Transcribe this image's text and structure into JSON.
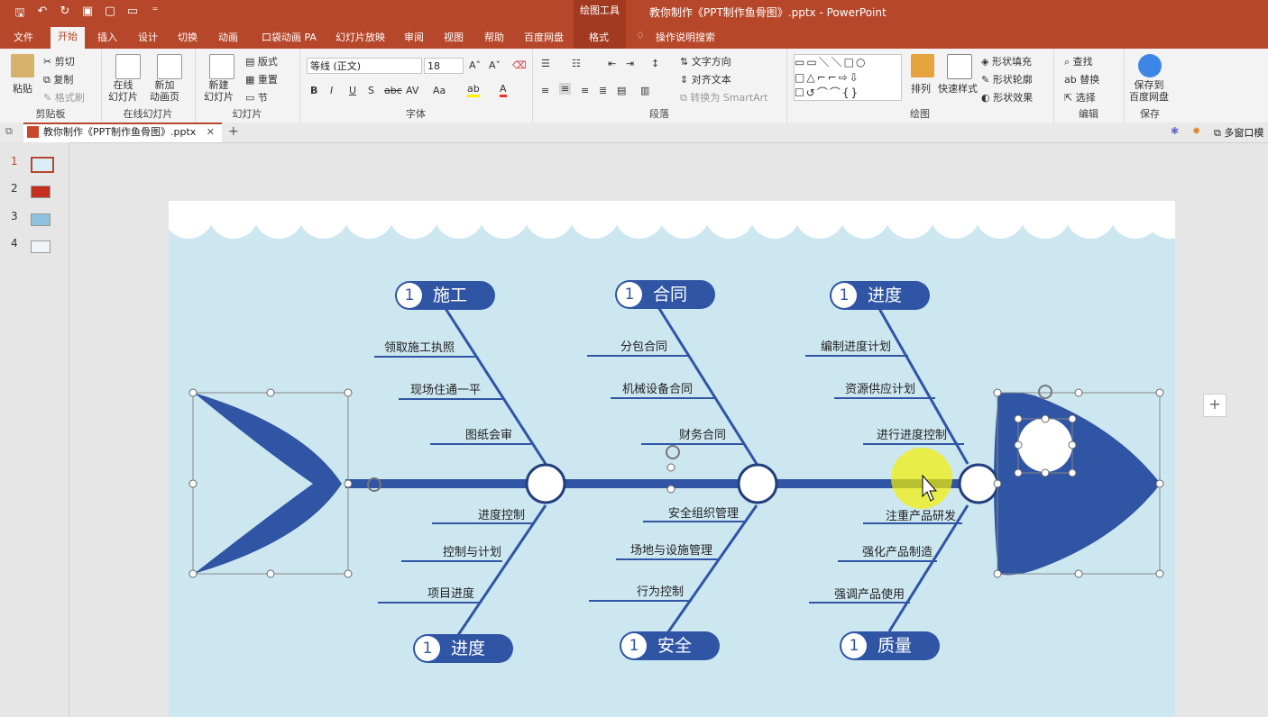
{
  "titlebar": {
    "context_tools": "绘图工具",
    "doc_title": "教你制作《PPT制作鱼骨图》.pptx  -  PowerPoint"
  },
  "tabs": [
    "文件",
    "开始",
    "插入",
    "设计",
    "切换",
    "动画",
    "口袋动画 PA",
    "幻灯片放映",
    "审阅",
    "视图",
    "帮助",
    "百度网盘",
    "格式"
  ],
  "tell_me": "操作说明搜索",
  "ribbon": {
    "clipboard": {
      "paste": "粘贴",
      "cut": "剪切",
      "copy": "复制",
      "format_painter": "格式刷",
      "label": "剪贴板"
    },
    "online": {
      "online_slides": "在线\n幻灯片",
      "new_anim": "新加\n动画页",
      "label": "在线幻灯片"
    },
    "slides": {
      "new_slide": "新建\n幻灯片",
      "layout": "版式",
      "reset": "重置",
      "section": "节",
      "label": "幻灯片"
    },
    "font": {
      "name": "等线 (正文)",
      "size": "18",
      "label": "字体"
    },
    "paragraph": {
      "text_direction": "文字方向",
      "align_text": "对齐文本",
      "smartart": "转换为 SmartArt",
      "label": "段落"
    },
    "drawing": {
      "arrange": "排列",
      "quick_styles": "快速样式",
      "shape_fill": "形状填充",
      "shape_outline": "形状轮廓",
      "shape_effects": "形状效果",
      "label": "绘图"
    },
    "editing": {
      "find": "查找",
      "replace": "替换",
      "select": "选择",
      "label": "编辑"
    },
    "save": {
      "save_baidu": "保存到\n百度网盘",
      "label": "保存"
    }
  },
  "docbar": {
    "doc_tab": "教你制作《PPT制作鱼骨图》.pptx",
    "multi_window": "多窗口模"
  },
  "thumbnails": [
    "1",
    "2",
    "3",
    "4"
  ],
  "slide": {
    "pills": [
      {
        "num": "1",
        "text": "施工"
      },
      {
        "num": "1",
        "text": "合同"
      },
      {
        "num": "1",
        "text": "进度"
      },
      {
        "num": "1",
        "text": "进度"
      },
      {
        "num": "1",
        "text": "安全"
      },
      {
        "num": "1",
        "text": "质量"
      }
    ],
    "branch_items": {
      "top1": [
        "领取施工执照",
        "现场住通一平",
        "图纸会审"
      ],
      "top2": [
        "分包合同",
        "机械设备合同",
        "财务合同"
      ],
      "top3": [
        "编制进度计划",
        "资源供应计划",
        "进行进度控制"
      ],
      "bottom1": [
        "进度控制",
        "控制与计划",
        "项目进度"
      ],
      "bottom2": [
        "安全组织管理",
        "场地与设施管理",
        "行为控制"
      ],
      "bottom3": [
        "注重产品研发",
        "强化产品制造",
        "强调产品使用"
      ]
    }
  },
  "colors": {
    "ribbon_red": "#b7472a",
    "fish_blue": "#2f55a4",
    "slide_bg": "#cde7f0"
  }
}
